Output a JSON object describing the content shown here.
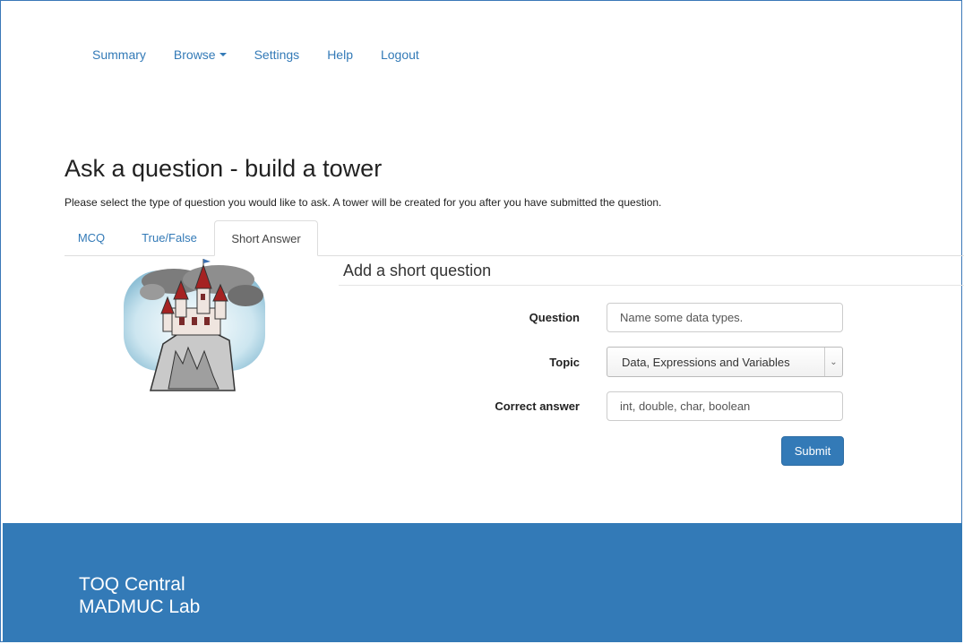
{
  "nav": {
    "summary": "Summary",
    "browse": "Browse",
    "settings": "Settings",
    "help": "Help",
    "logout": "Logout"
  },
  "page": {
    "title": "Ask a question - build a tower",
    "intro": "Please select the type of question you would like to ask. A tower will be created for you after you have submitted the question."
  },
  "tabs": [
    {
      "label": "MCQ",
      "active": false
    },
    {
      "label": "True/False",
      "active": false
    },
    {
      "label": "Short Answer",
      "active": true
    }
  ],
  "form": {
    "heading": "Add a short question",
    "question_label": "Question",
    "question_value": "Name some data types.",
    "topic_label": "Topic",
    "topic_value": "Data, Expressions and Variables",
    "answer_label": "Correct answer",
    "answer_value": "int, double, char, boolean",
    "submit_label": "Submit"
  },
  "footer": {
    "line1": "TOQ Central",
    "line2": "MADMUC Lab"
  },
  "colors": {
    "link": "#337ab7",
    "footer_bg": "#337ab7",
    "button_bg": "#337ab7"
  }
}
